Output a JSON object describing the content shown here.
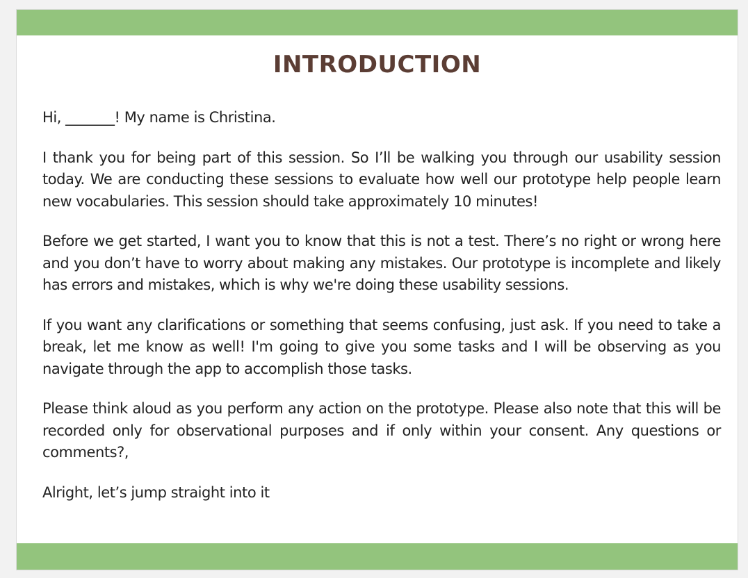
{
  "document": {
    "title": "INTRODUCTION",
    "paragraphs": [
      "Hi, _______! My name is Christina.",
      "I thank you for being part of this session. So I’ll be walking you through our usability session today. We are conducting these sessions to evaluate how well our prototype help people learn new vocabularies. This session should take approximately 10 minutes!",
      "Before we get started, I want you to know that this is not a test. There’s no right or wrong here and you don’t have to worry about making any mistakes. Our prototype is incomplete and likely has errors and mistakes, which is why we're doing these usability sessions.",
      "If you want any clarifications or something that seems confusing, just ask. If you need to take a break, let me know as well! I'm going to give you some tasks and I will be observing as you navigate through the app to accomplish those tasks.",
      "Please think aloud as you perform any action on the prototype. Please also note that this will be recorded only for observational purposes and if only within your consent. Any questions or comments?,",
      "Alright, let’s jump straight into it"
    ]
  },
  "colors": {
    "accent_bar": "#93c47d",
    "title": "#5b3d34",
    "body_text": "#222222",
    "page_background": "#ffffff"
  }
}
